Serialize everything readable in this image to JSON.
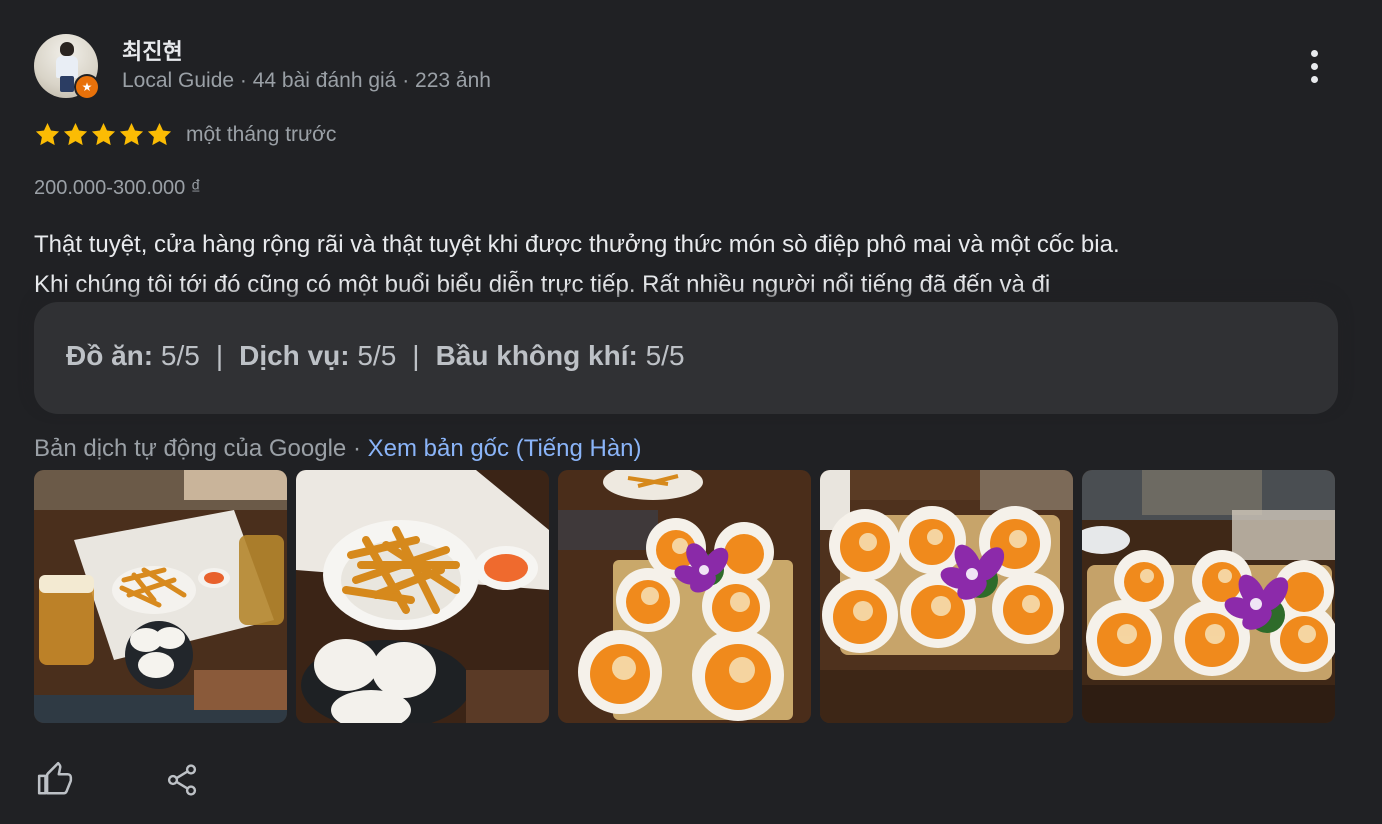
{
  "author": {
    "name": "최진현",
    "meta": "Local Guide · 44 bài đánh giá · 223 ảnh",
    "avatar_icon": "user-avatar",
    "badge_icon": "local-guide-star-badge"
  },
  "menu": {
    "icon": "more-vertical-icon"
  },
  "rating": {
    "stars": 5,
    "max": 5,
    "star_color": "#fbbc04"
  },
  "time": "một tháng trước",
  "price": "200.000-300.000 ₫",
  "review_lines": [
    "Thật tuyệt, cửa hàng rộng rãi và thật tuyệt khi được thưởng thức món sò điệp phô mai và một cốc bia.",
    "Khi chúng tôi tới đó cũng có một buổi biểu diễn trực tiếp. Rất nhiều người nổi tiếng đã đến và đi"
  ],
  "sub_ratings": [
    {
      "label": "Đồ ăn:",
      "value": "5/5"
    },
    {
      "label": "Dịch vụ:",
      "value": "5/5"
    },
    {
      "label": "Bầu không khí:",
      "value": "5/5"
    }
  ],
  "translation": {
    "text": "Bản dịch tự động của Google",
    "separator": " · ",
    "link": "Xem bản gốc (Tiếng Hàn)"
  },
  "photos": [
    {
      "subject": "fries-and-beer-table"
    },
    {
      "subject": "fries-closeup"
    },
    {
      "subject": "cheese-scallops-board"
    },
    {
      "subject": "cheese-scallops-flower"
    },
    {
      "subject": "cheese-scallops-plate"
    }
  ],
  "actions": {
    "like_icon": "thumb-up-icon",
    "share_icon": "share-icon"
  },
  "colors": {
    "background": "#202124",
    "link": "#8ab4f8",
    "muted": "#9aa0a6",
    "box": "#303134"
  }
}
